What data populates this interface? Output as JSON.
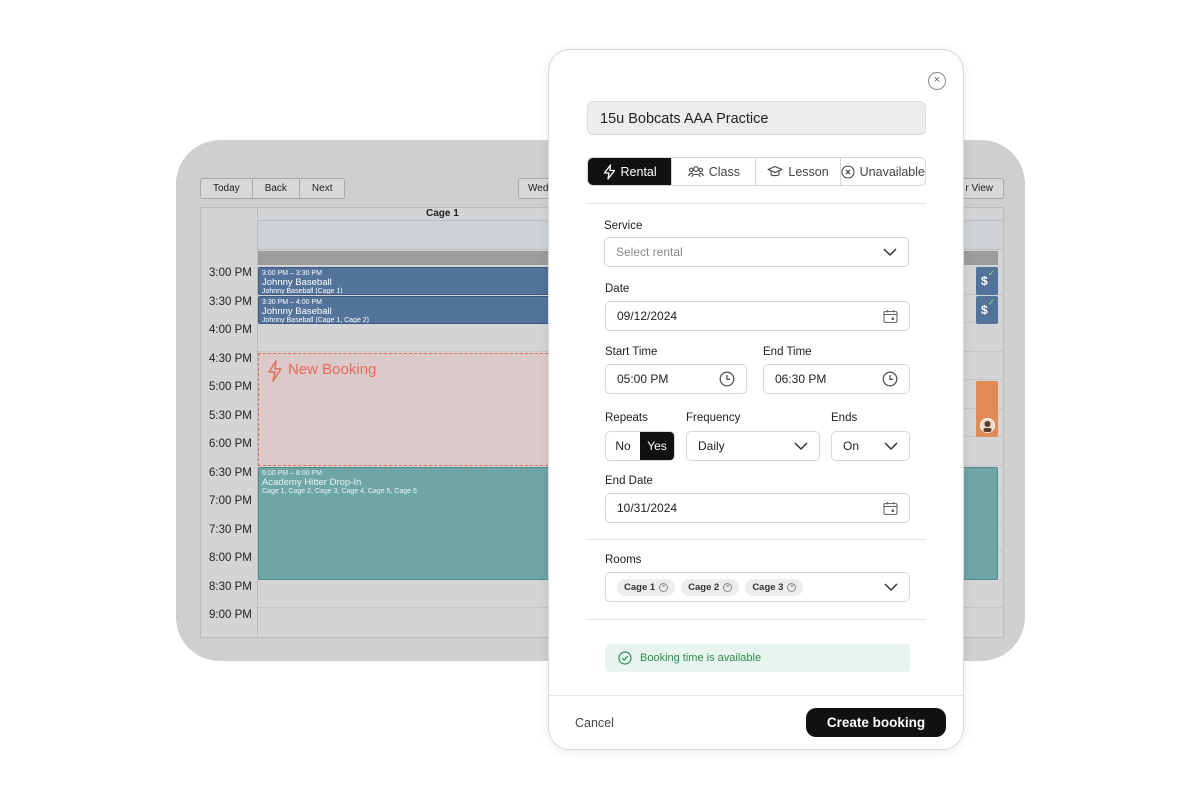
{
  "calendar": {
    "toolbar": {
      "today": "Today",
      "back": "Back",
      "next": "Next",
      "day_partial": "Wed",
      "view_partial": "r View"
    },
    "resource": "Cage 1",
    "times": [
      "3:00 PM",
      "3:30 PM",
      "4:00 PM",
      "4:30 PM",
      "5:00 PM",
      "5:30 PM",
      "6:00 PM",
      "6:30 PM",
      "7:00 PM",
      "7:30 PM",
      "8:00 PM",
      "8:30 PM",
      "9:00 PM"
    ],
    "events": [
      {
        "time": "3:00 PM – 3:30 PM",
        "name": "Johnny Baseball",
        "sub": "Johnny Baseball (Cage 1)"
      },
      {
        "time": "3:30 PM – 4:00 PM",
        "name": "Johnny Baseball",
        "sub": "Johnny Baseball (Cage 1, Cage 2)"
      },
      {
        "time": "6:00 PM – 8:00 PM",
        "name": "Academy Hitter Drop-In",
        "sub": "Cage 1, Cage 2, Cage 3, Cage 4, Cage 5, Cage 6"
      }
    ],
    "new_booking": "New Booking",
    "dollar": "$",
    "colors": {
      "blue_event": "#53739b",
      "teal_event": "#6ea6a8",
      "orange_event": "#e08b56",
      "new_booking": "#e56b5b"
    }
  },
  "modal": {
    "close": "×",
    "title": "15u Bobcats AAA Practice",
    "tabs": [
      {
        "label": "Rental",
        "icon": "bolt-icon",
        "active": true
      },
      {
        "label": "Class",
        "icon": "users-icon",
        "active": false
      },
      {
        "label": "Lesson",
        "icon": "graduation-cap-icon",
        "active": false
      },
      {
        "label": "Unavailable",
        "icon": "x-circle-icon",
        "active": false
      }
    ],
    "service": {
      "label": "Service",
      "placeholder": "Select rental"
    },
    "date": {
      "label": "Date",
      "value": "09/12/2024"
    },
    "start_time": {
      "label": "Start Time",
      "value": "05:00 PM"
    },
    "end_time": {
      "label": "End Time",
      "value": "06:30 PM"
    },
    "repeats": {
      "label": "Repeats",
      "no": "No",
      "yes": "Yes",
      "selected": "Yes"
    },
    "frequency": {
      "label": "Frequency",
      "value": "Daily"
    },
    "ends": {
      "label": "Ends",
      "value": "On"
    },
    "end_date": {
      "label": "End Date",
      "value": "10/31/2024"
    },
    "rooms": {
      "label": "Rooms",
      "chips": [
        "Cage 1",
        "Cage 2",
        "Cage 3"
      ]
    },
    "availability": "Booking time is available",
    "cancel": "Cancel",
    "create": "Create booking",
    "colors": {
      "primary": "#111111",
      "success": "#2e8b4f",
      "success_bg": "#e8f5ee"
    }
  }
}
